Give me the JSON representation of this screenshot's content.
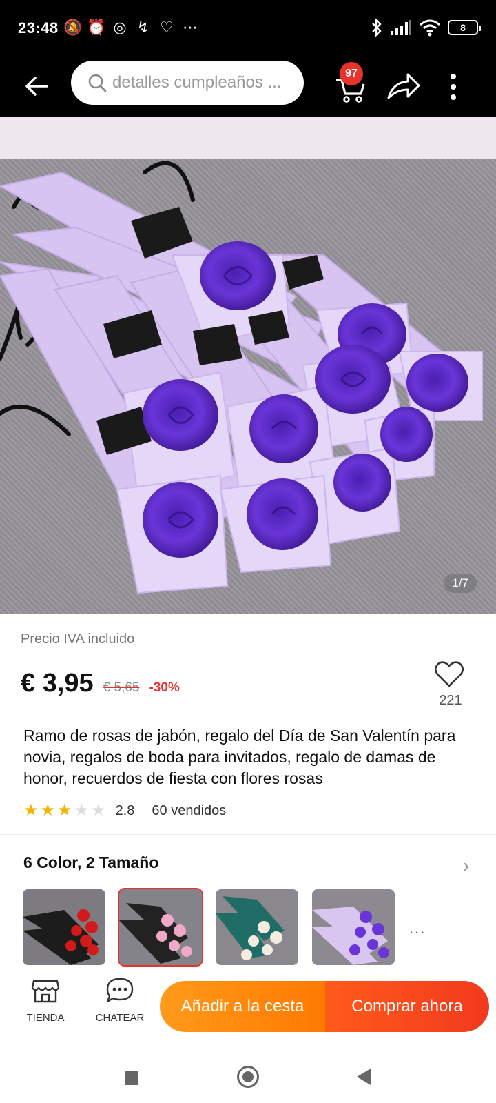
{
  "status_bar": {
    "time": "23:48",
    "battery": "8",
    "notification_icons": [
      "mute-icon",
      "alarm-icon",
      "whatsapp-icon",
      "missed-call-icon",
      "heart-icon",
      "more-dots-icon"
    ],
    "system_icons": [
      "bluetooth-icon",
      "signal-icon",
      "wifi-icon",
      "battery-icon"
    ]
  },
  "top_nav": {
    "search_placeholder": "detalles cumpleaños ...",
    "cart_badge": "97"
  },
  "gallery": {
    "counter": "1/7"
  },
  "product": {
    "vat_label": "Precio IVA incluido",
    "price": "€ 3,95",
    "old_price": "€ 5,65",
    "discount": "-30%",
    "favorites": "221",
    "title": "Ramo de rosas de jabón, regalo del Día de San Valentín para novia, regalos de boda para invitados, regalo de damas de honor, recuerdos de fiesta con flores rosas",
    "rating_value": "2.8",
    "rating_stars": 2.8,
    "sold": "60 vendidos"
  },
  "variants": {
    "label": "6 Color, 2 Tamaño",
    "more": "...",
    "thumbnails": [
      {
        "color": "red",
        "selected": false
      },
      {
        "color": "pink",
        "selected": true
      },
      {
        "color": "white",
        "selected": false
      },
      {
        "color": "purple",
        "selected": false
      }
    ]
  },
  "actions": {
    "store_label": "TIENDA",
    "chat_label": "CHATEAR",
    "add_to_cart": "Añadir a la cesta",
    "buy_now": "Comprar ahora"
  },
  "colors": {
    "accent_red": "#e8322a",
    "add_orange": "#ff8a0d",
    "buy_red": "#f2451d",
    "star": "#f5b400"
  }
}
